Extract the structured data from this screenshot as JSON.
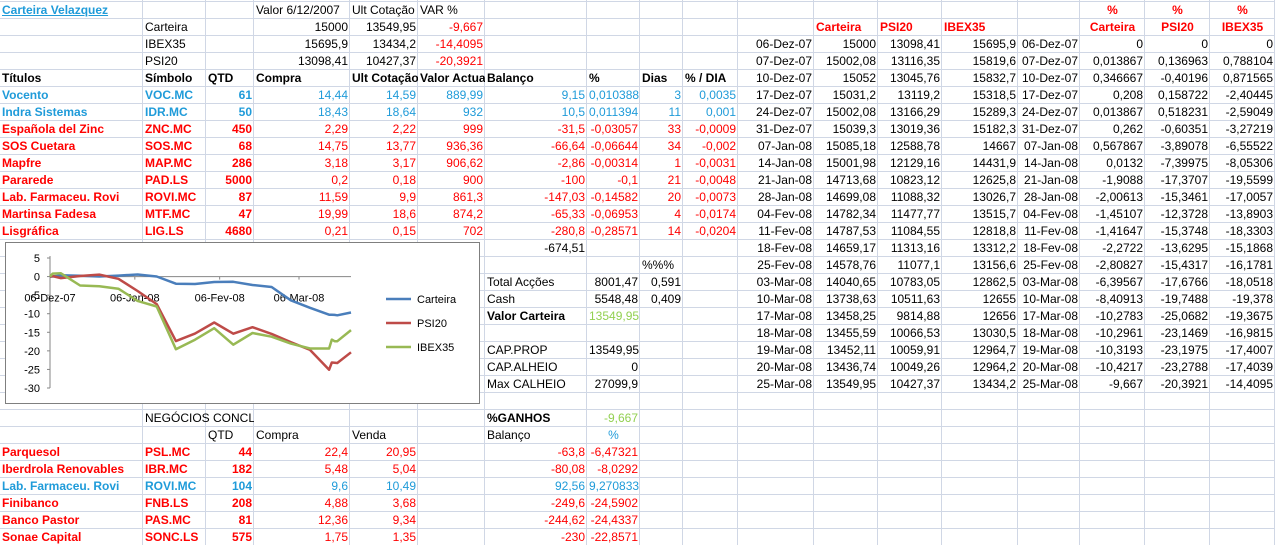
{
  "title": "Carteira Velazquez",
  "summary": {
    "col_headers": [
      "Valor 6/12/2007",
      "Ult Cotação",
      "VAR %"
    ],
    "rows": [
      {
        "label": "Carteira",
        "valor": "15000",
        "ult": "13549,95",
        "var": "-9,667"
      },
      {
        "label": "IBEX35",
        "valor": "15695,9",
        "ult": "13434,2",
        "var": "-14,4095"
      },
      {
        "label": "PSI20",
        "valor": "13098,41",
        "ult": "10427,37",
        "var": "-20,3921"
      }
    ]
  },
  "positions": {
    "headers": [
      "Títulos",
      "Símbolo",
      "QTD",
      "Compra",
      "Ult Cotação",
      "Valor Actual",
      "Balanço",
      "%",
      "Dias",
      "% / DIA"
    ],
    "rows": [
      {
        "titulo": "Vocento",
        "simbolo": "VOC.MC",
        "qtd": "61",
        "compra": "14,44",
        "ult": "14,59",
        "valor": "889,99",
        "balanco": "9,15",
        "pct": "0,010388",
        "dias": "3",
        "dia": "0,0035",
        "color": "#1f9bd9"
      },
      {
        "titulo": "Indra Sistemas",
        "simbolo": "IDR.MC",
        "qtd": "50",
        "compra": "18,43",
        "ult": "18,64",
        "valor": "932",
        "balanco": "10,5",
        "pct": "0,011394",
        "dias": "11",
        "dia": "0,001",
        "color": "#1f9bd9"
      },
      {
        "titulo": "Española del Zinc",
        "simbolo": "ZNC.MC",
        "qtd": "450",
        "compra": "2,29",
        "ult": "2,22",
        "valor": "999",
        "balanco": "-31,5",
        "pct": "-0,03057",
        "dias": "33",
        "dia": "-0,0009",
        "color": "#ff0000"
      },
      {
        "titulo": "SOS Cuetara",
        "simbolo": "SOS.MC",
        "qtd": "68",
        "compra": "14,75",
        "ult": "13,77",
        "valor": "936,36",
        "balanco": "-66,64",
        "pct": "-0,06644",
        "dias": "34",
        "dia": "-0,002",
        "color": "#ff0000"
      },
      {
        "titulo": "Mapfre",
        "simbolo": "MAP.MC",
        "qtd": "286",
        "compra": "3,18",
        "ult": "3,17",
        "valor": "906,62",
        "balanco": "-2,86",
        "pct": "-0,00314",
        "dias": "1",
        "dia": "-0,0031",
        "color": "#ff0000"
      },
      {
        "titulo": "Pararede",
        "simbolo": "PAD.LS",
        "qtd": "5000",
        "compra": "0,2",
        "ult": "0,18",
        "valor": "900",
        "balanco": "-100",
        "pct": "-0,1",
        "dias": "21",
        "dia": "-0,0048",
        "color": "#ff0000"
      },
      {
        "titulo": "Lab. Farmaceu. Rovi",
        "simbolo": "ROVI.MC",
        "qtd": "87",
        "compra": "11,59",
        "ult": "9,9",
        "valor": "861,3",
        "balanco": "-147,03",
        "pct": "-0,14582",
        "dias": "20",
        "dia": "-0,0073",
        "color": "#ff0000"
      },
      {
        "titulo": "Martinsa Fadesa",
        "simbolo": "MTF.MC",
        "qtd": "47",
        "compra": "19,99",
        "ult": "18,6",
        "valor": "874,2",
        "balanco": "-65,33",
        "pct": "-0,06953",
        "dias": "4",
        "dia": "-0,0174",
        "color": "#ff0000"
      },
      {
        "titulo": "Lisgráfica",
        "simbolo": "LIG.LS",
        "qtd": "4680",
        "compra": "0,21",
        "ult": "0,15",
        "valor": "702",
        "balanco": "-280,8",
        "pct": "-0,28571",
        "dias": "14",
        "dia": "-0,0204",
        "color": "#ff0000"
      }
    ],
    "balanco_total": "-674,51"
  },
  "totals": {
    "pct_header": "%%%",
    "total_accoes_label": "Total Acções",
    "total_accoes": "8001,47",
    "total_accoes_pct": "0,591",
    "cash_label": "Cash",
    "cash": "5548,48",
    "cash_pct": "0,409",
    "valor_carteira_label": "Valor Carteira",
    "valor_carteira": "13549,95",
    "cap_prop_label": "CAP.PROP",
    "cap_prop": "13549,95",
    "cap_alheio_label": "CAP.ALHEIO",
    "cap_alheio": "0",
    "max_calheio_label": "Max CALHEIO",
    "max_calheio": "27099,9",
    "ganhos_label": "%GANHOS",
    "ganhos": "-9,667"
  },
  "closed": {
    "title": "NEGÓCIOS CONCLUÍDOS",
    "headers": [
      "QTD",
      "Compra",
      "Venda"
    ],
    "balanco_header": "Balanço",
    "pct_header": "%",
    "rows": [
      {
        "titulo": "Parquesol",
        "simbolo": "PSL.MC",
        "qtd": "44",
        "compra": "22,4",
        "venda": "20,95",
        "balanco": "-63,8",
        "pct": "-6,47321",
        "color": "#ff0000"
      },
      {
        "titulo": "Iberdrola Renovables",
        "simbolo": "IBR.MC",
        "qtd": "182",
        "compra": "5,48",
        "venda": "5,04",
        "balanco": "-80,08",
        "pct": "-8,0292",
        "color": "#ff0000"
      },
      {
        "titulo": "Lab. Farmaceu. Rovi",
        "simbolo": "ROVI.MC",
        "qtd": "104",
        "compra": "9,6",
        "venda": "10,49",
        "balanco": "92,56",
        "pct": "9,270833",
        "color": "#1f9bd9"
      },
      {
        "titulo": "Finibanco",
        "simbolo": "FNB.LS",
        "qtd": "208",
        "compra": "4,88",
        "venda": "3,68",
        "balanco": "-249,6",
        "pct": "-24,5902",
        "color": "#ff0000"
      },
      {
        "titulo": "Banco Pastor",
        "simbolo": "PAS.MC",
        "qtd": "81",
        "compra": "12,36",
        "venda": "9,34",
        "balanco": "-244,62",
        "pct": "-24,4337",
        "color": "#ff0000"
      },
      {
        "titulo": "Sonae Capital",
        "simbolo": "SONC.LS",
        "qtd": "575",
        "compra": "1,75",
        "venda": "1,35",
        "balanco": "-230",
        "pct": "-22,8571",
        "color": "#ff0000"
      }
    ]
  },
  "history": {
    "headers": [
      "Carteira",
      "PSI20",
      "IBEX35"
    ],
    "rows": [
      {
        "date": "06-Dez-07",
        "carteira": "15000",
        "psi20": "13098,41",
        "ibex35": "15695,9"
      },
      {
        "date": "07-Dez-07",
        "carteira": "15002,08",
        "psi20": "13116,35",
        "ibex35": "15819,6"
      },
      {
        "date": "10-Dez-07",
        "carteira": "15052",
        "psi20": "13045,76",
        "ibex35": "15832,7"
      },
      {
        "date": "17-Dez-07",
        "carteira": "15031,2",
        "psi20": "13119,2",
        "ibex35": "15318,5"
      },
      {
        "date": "24-Dez-07",
        "carteira": "15002,08",
        "psi20": "13166,29",
        "ibex35": "15289,3"
      },
      {
        "date": "31-Dez-07",
        "carteira": "15039,3",
        "psi20": "13019,36",
        "ibex35": "15182,3"
      },
      {
        "date": "07-Jan-08",
        "carteira": "15085,18",
        "psi20": "12588,78",
        "ibex35": "14667"
      },
      {
        "date": "14-Jan-08",
        "carteira": "15001,98",
        "psi20": "12129,16",
        "ibex35": "14431,9"
      },
      {
        "date": "21-Jan-08",
        "carteira": "14713,68",
        "psi20": "10823,12",
        "ibex35": "12625,8"
      },
      {
        "date": "28-Jan-08",
        "carteira": "14699,08",
        "psi20": "11088,32",
        "ibex35": "13026,7"
      },
      {
        "date": "04-Fev-08",
        "carteira": "14782,34",
        "psi20": "11477,77",
        "ibex35": "13515,7"
      },
      {
        "date": "11-Fev-08",
        "carteira": "14787,53",
        "psi20": "11084,55",
        "ibex35": "12818,8"
      },
      {
        "date": "18-Fev-08",
        "carteira": "14659,17",
        "psi20": "11313,16",
        "ibex35": "13312,2"
      },
      {
        "date": "25-Fev-08",
        "carteira": "14578,76",
        "psi20": "11077,1",
        "ibex35": "13156,6"
      },
      {
        "date": "03-Mar-08",
        "carteira": "14040,65",
        "psi20": "10783,05",
        "ibex35": "12862,5"
      },
      {
        "date": "10-Mar-08",
        "carteira": "13738,63",
        "psi20": "10511,63",
        "ibex35": "12655"
      },
      {
        "date": "17-Mar-08",
        "carteira": "13458,25",
        "psi20": "9814,88",
        "ibex35": "12656"
      },
      {
        "date": "18-Mar-08",
        "carteira": "13455,59",
        "psi20": "10066,53",
        "ibex35": "13030,5"
      },
      {
        "date": "19-Mar-08",
        "carteira": "13452,11",
        "psi20": "10059,91",
        "ibex35": "12964,7"
      },
      {
        "date": "20-Mar-08",
        "carteira": "13436,74",
        "psi20": "10049,26",
        "ibex35": "12964,2"
      },
      {
        "date": "25-Mar-08",
        "carteira": "13549,95",
        "psi20": "10427,37",
        "ibex35": "13434,2"
      }
    ]
  },
  "pct_history": {
    "headers_top": [
      "%",
      "%",
      "%"
    ],
    "headers": [
      "Carteira",
      "PSI20",
      "IBEX35"
    ],
    "rows": [
      {
        "date": "06-Dez-07",
        "carteira": "0",
        "psi20": "0",
        "ibex35": "0"
      },
      {
        "date": "07-Dez-07",
        "carteira": "0,013867",
        "psi20": "0,136963",
        "ibex35": "0,788104"
      },
      {
        "date": "10-Dez-07",
        "carteira": "0,346667",
        "psi20": "-0,40196",
        "ibex35": "0,871565"
      },
      {
        "date": "17-Dez-07",
        "carteira": "0,208",
        "psi20": "0,158722",
        "ibex35": "-2,40445"
      },
      {
        "date": "24-Dez-07",
        "carteira": "0,013867",
        "psi20": "0,518231",
        "ibex35": "-2,59049"
      },
      {
        "date": "31-Dez-07",
        "carteira": "0,262",
        "psi20": "-0,60351",
        "ibex35": "-3,27219"
      },
      {
        "date": "07-Jan-08",
        "carteira": "0,567867",
        "psi20": "-3,89078",
        "ibex35": "-6,55522"
      },
      {
        "date": "14-Jan-08",
        "carteira": "0,0132",
        "psi20": "-7,39975",
        "ibex35": "-8,05306"
      },
      {
        "date": "21-Jan-08",
        "carteira": "-1,9088",
        "psi20": "-17,3707",
        "ibex35": "-19,5599"
      },
      {
        "date": "28-Jan-08",
        "carteira": "-2,00613",
        "psi20": "-15,3461",
        "ibex35": "-17,0057"
      },
      {
        "date": "04-Fev-08",
        "carteira": "-1,45107",
        "psi20": "-12,3728",
        "ibex35": "-13,8903"
      },
      {
        "date": "11-Fev-08",
        "carteira": "-1,41647",
        "psi20": "-15,3748",
        "ibex35": "-18,3303"
      },
      {
        "date": "18-Fev-08",
        "carteira": "-2,2722",
        "psi20": "-13,6295",
        "ibex35": "-15,1868"
      },
      {
        "date": "25-Fev-08",
        "carteira": "-2,80827",
        "psi20": "-15,4317",
        "ibex35": "-16,1781"
      },
      {
        "date": "03-Mar-08",
        "carteira": "-6,39567",
        "psi20": "-17,6766",
        "ibex35": "-18,0518"
      },
      {
        "date": "10-Mar-08",
        "carteira": "-8,40913",
        "psi20": "-19,7488",
        "ibex35": "-19,378"
      },
      {
        "date": "17-Mar-08",
        "carteira": "-10,2783",
        "psi20": "-25,0682",
        "ibex35": "-19,3675"
      },
      {
        "date": "18-Mar-08",
        "carteira": "-10,2961",
        "psi20": "-23,1469",
        "ibex35": "-16,9815"
      },
      {
        "date": "19-Mar-08",
        "carteira": "-10,3193",
        "psi20": "-23,1975",
        "ibex35": "-17,4007"
      },
      {
        "date": "20-Mar-08",
        "carteira": "-10,4217",
        "psi20": "-23,2788",
        "ibex35": "-17,4039"
      },
      {
        "date": "25-Mar-08",
        "carteira": "-9,667",
        "psi20": "-20,3921",
        "ibex35": "-14,4095"
      }
    ]
  },
  "chart_data": {
    "type": "line",
    "x": [
      "06-Dez-07",
      "07-Dez-07",
      "10-Dez-07",
      "17-Dez-07",
      "24-Dez-07",
      "31-Dez-07",
      "07-Jan-08",
      "14-Jan-08",
      "21-Jan-08",
      "28-Jan-08",
      "04-Fev-08",
      "11-Fev-08",
      "18-Fev-08",
      "25-Fev-08",
      "03-Mar-08",
      "10-Mar-08",
      "17-Mar-08",
      "18-Mar-08",
      "19-Mar-08",
      "20-Mar-08",
      "25-Mar-08"
    ],
    "x_ticks": [
      "06-Dez-07",
      "06-Jan-08",
      "06-Fev-08",
      "06-Mar-08"
    ],
    "y_ticks": [
      5,
      0,
      -5,
      -10,
      -15,
      -20,
      -25,
      -30
    ],
    "ylim": [
      -30,
      5
    ],
    "legend_position": "right",
    "series": [
      {
        "name": "Carteira",
        "color": "#4a7ebb",
        "values": [
          0,
          0.013867,
          0.346667,
          0.208,
          0.013867,
          0.262,
          0.567867,
          0.0132,
          -1.9088,
          -2.00613,
          -1.45107,
          -1.41647,
          -2.2722,
          -2.80827,
          -6.39567,
          -8.40913,
          -10.2783,
          -10.2961,
          -10.3193,
          -10.4217,
          -9.667
        ]
      },
      {
        "name": "PSI20",
        "color": "#be4b48",
        "values": [
          0,
          0.136963,
          -0.40196,
          0.158722,
          0.518231,
          -0.60351,
          -3.89078,
          -7.39975,
          -17.3707,
          -15.3461,
          -12.3728,
          -15.3748,
          -13.6295,
          -15.4317,
          -17.6766,
          -19.7488,
          -25.0682,
          -23.1469,
          -23.1975,
          -23.2788,
          -20.3921
        ]
      },
      {
        "name": "IBEX35",
        "color": "#98b954",
        "values": [
          0,
          0.788104,
          0.871565,
          -2.40445,
          -2.59049,
          -3.27219,
          -6.55522,
          -8.05306,
          -19.5599,
          -17.0057,
          -13.8903,
          -18.3303,
          -15.1868,
          -16.1781,
          -18.0518,
          -19.378,
          -19.3675,
          -16.9815,
          -17.4007,
          -17.4039,
          -14.4095
        ]
      }
    ]
  }
}
